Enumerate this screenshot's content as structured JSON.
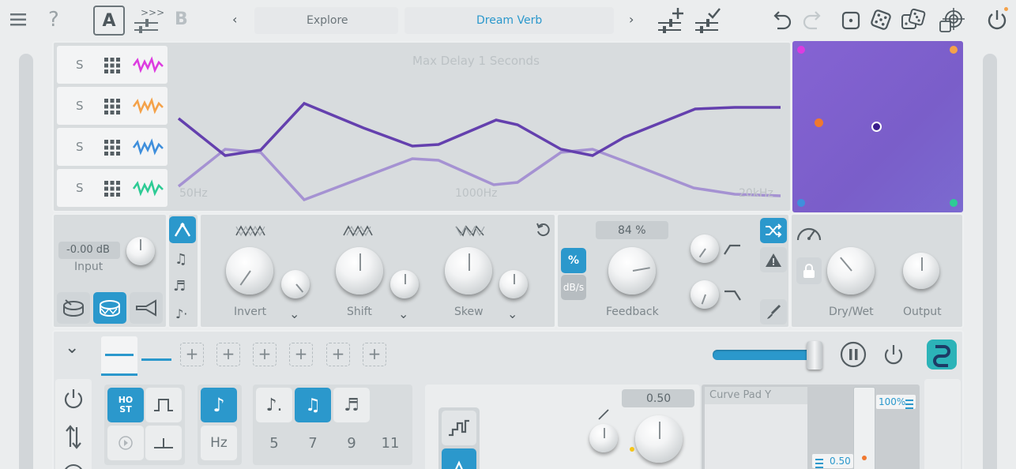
{
  "topbar": {
    "preset_a": "A",
    "preset_b": "B",
    "mode": "Explore",
    "preset_name": "Dream Verb",
    "icons": [
      "menu-icon",
      "help-icon",
      "copy-a-to-b-icon",
      "prev-icon",
      "next-icon",
      "add-preset-icon",
      "save-preset-icon",
      "undo-icon",
      "redo-icon",
      "random-die-1-icon",
      "random-die-5-icon",
      "random-dice-icon",
      "target-dice-icon",
      "power-icon"
    ]
  },
  "bands": [
    {
      "s": "S",
      "color": "#dd3ce0"
    },
    {
      "s": "S",
      "color": "#f4a24a"
    },
    {
      "s": "S",
      "color": "#3f8fdc"
    },
    {
      "s": "S",
      "color": "#2ecb95"
    }
  ],
  "graph": {
    "title": "Max Delay 1 Seconds",
    "freq_labels": [
      "50Hz",
      "1000Hz",
      "20kHz"
    ]
  },
  "xy_pad": {
    "accent": "#7d5ed0"
  },
  "input": {
    "value": "-0.00 dB",
    "label": "Input"
  },
  "mod": {
    "invert": "Invert",
    "shift": "Shift",
    "skew": "Skew"
  },
  "feedback": {
    "value": "84 %",
    "pct": "%",
    "dbs": "dB/s",
    "label": "Feedback"
  },
  "outputs": {
    "drywet": "Dry/Wet",
    "output": "Output"
  },
  "lfo": {
    "host_line1": "HO",
    "host_line2": "ST",
    "hz": "Hz",
    "numbers": [
      "5",
      "7",
      "9",
      "11"
    ],
    "value": "0.50",
    "curve_pad": "Curve Pad Y",
    "pct100": "100%",
    "val050": "0.50"
  },
  "colors": {
    "accent": "#2b98cc",
    "curve_dark": "#6440ae",
    "curve_light": "#a592d2"
  }
}
